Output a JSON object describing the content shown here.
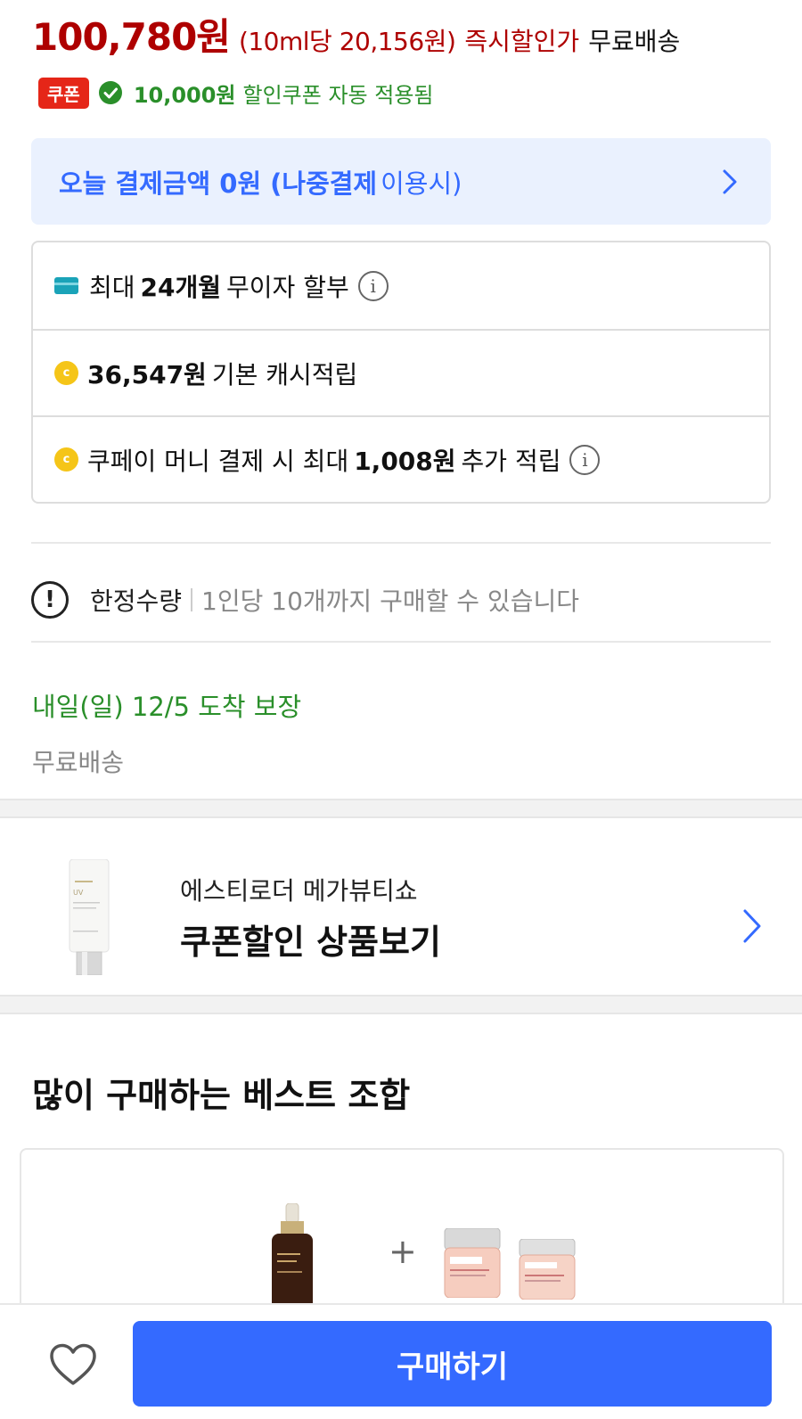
{
  "price": {
    "sale_price": "100,780원",
    "unit_price": "(10ml당 20,156원)",
    "label": "즉시할인가",
    "shipping": "무료배송"
  },
  "coupon": {
    "badge": "쿠폰",
    "amount": "10,000원",
    "text": "할인쿠폰 자동 적용됨",
    "accent_color": "#2a8f2a"
  },
  "pay_banner": {
    "part1": "오늘 결제금액 0원",
    "part2": "(나중결제",
    "part3": "이용시)"
  },
  "benefits": [
    {
      "icon": "card-icon",
      "prefix": "최대",
      "bold": "24개월",
      "suffix": "무이자 할부",
      "info": true
    },
    {
      "icon": "coin-icon",
      "prefix": "",
      "bold": "36,547원",
      "suffix": "기본 캐시적립",
      "info": false
    },
    {
      "icon": "coin-icon",
      "prefix": "쿠페이 머니 결제 시 최대",
      "bold": "1,008원",
      "suffix": "추가 적립",
      "info": true
    }
  ],
  "limit": {
    "title": "한정수량",
    "text": "1인당 10개까지 구매할 수 있습니다"
  },
  "delivery": {
    "date": "내일(일) 12/5 도착 보장",
    "fee": "무료배송"
  },
  "promo": {
    "subtitle": "에스티로더 메가뷰티쇼",
    "title": "쿠폰할인 상품보기"
  },
  "best": {
    "title": "많이 구매하는 베스트 조합",
    "plus": "+"
  },
  "bottom": {
    "buy_label": "구매하기"
  },
  "colors": {
    "price_red": "#ae0000",
    "brand_blue": "#346aff",
    "banner_bg": "#eaf1fe",
    "coupon_red": "#e52618"
  }
}
